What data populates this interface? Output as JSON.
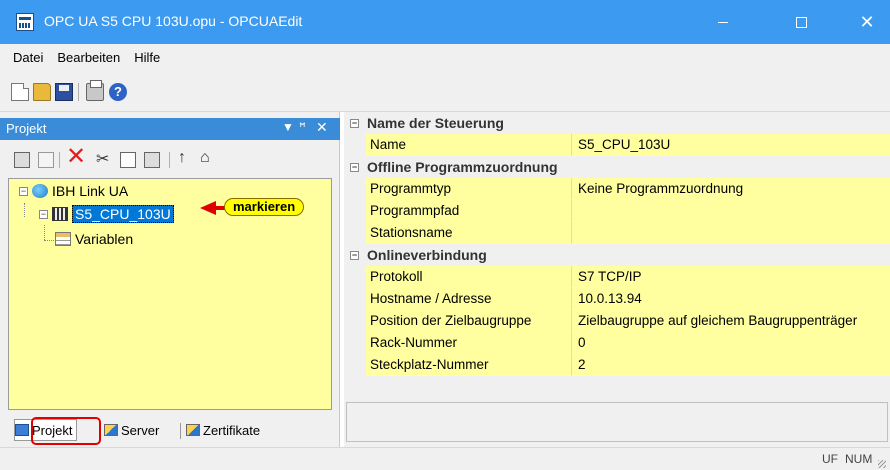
{
  "window": {
    "title": "OPC UA S5 CPU 103U.opu - OPCUAEdit",
    "controls": {
      "minimize": "—",
      "maximize": "☐",
      "close": "✕"
    }
  },
  "menu": [
    "Datei",
    "Bearbeiten",
    "Hilfe"
  ],
  "toolbar": {
    "icons": [
      "new-file-icon",
      "open-folder-icon",
      "save-icon",
      "print-icon",
      "help-icon"
    ],
    "help_glyph": "?"
  },
  "left_panel": {
    "title": "Projekt",
    "controls": {
      "dropdown": "▼",
      "pin": "ꟸ",
      "close": "✕"
    },
    "toolbar_glyphs": {
      "delete": "✕",
      "cut": "✂",
      "up": "↑",
      "home": "⌂"
    },
    "tree": {
      "root": {
        "label": "IBH Link UA",
        "expander": "−"
      },
      "child": {
        "label": "S5_CPU_103U",
        "expander": "−"
      },
      "grandchild": {
        "label": "Variablen"
      }
    },
    "callout": "markieren",
    "tabs": [
      "Projekt",
      "Server",
      "Zertifikate"
    ]
  },
  "property_grid": {
    "expander": "−",
    "categories": [
      {
        "title": "Name der Steuerung",
        "rows": [
          {
            "key": "Name",
            "value": "S5_CPU_103U"
          }
        ]
      },
      {
        "title": "Offline Programmzuordnung",
        "rows": [
          {
            "key": "Programmtyp",
            "value": "Keine Programmzuordnung"
          },
          {
            "key": "Programmpfad",
            "value": ""
          },
          {
            "key": "Stationsname",
            "value": ""
          }
        ]
      },
      {
        "title": "Onlineverbindung",
        "rows": [
          {
            "key": "Protokoll",
            "value": "S7 TCP/IP"
          },
          {
            "key": "Hostname / Adresse",
            "value": "10.0.13.94"
          },
          {
            "key": "Position der Zielbaugruppe",
            "value": "Zielbaugruppe auf gleichem Baugruppenträger"
          },
          {
            "key": "Rack-Nummer",
            "value": "0"
          },
          {
            "key": "Steckplatz-Nummer",
            "value": "2"
          }
        ]
      }
    ]
  },
  "statusbar": {
    "uf": "UF",
    "num": "NUM"
  },
  "colors": {
    "titlebar": "#3C9AF0",
    "panel_header": "#3A8CD8",
    "tree_background": "#FFFFA0",
    "selection": "#0078D7",
    "callout": "#FFFF00",
    "highlight": "#E00000"
  }
}
